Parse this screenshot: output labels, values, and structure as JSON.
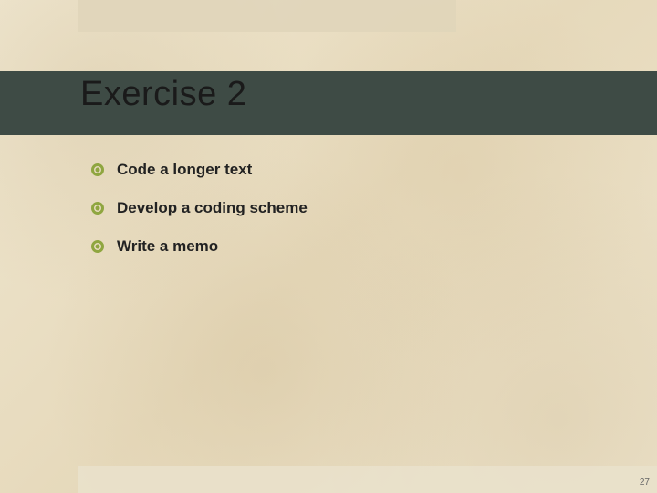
{
  "title": "Exercise 2",
  "bullets": [
    "Code a longer text",
    "Develop a coding scheme",
    "Write a memo"
  ],
  "page_number": "27",
  "accent_color": "#8fa640",
  "title_bar_color": "#3e4b45"
}
